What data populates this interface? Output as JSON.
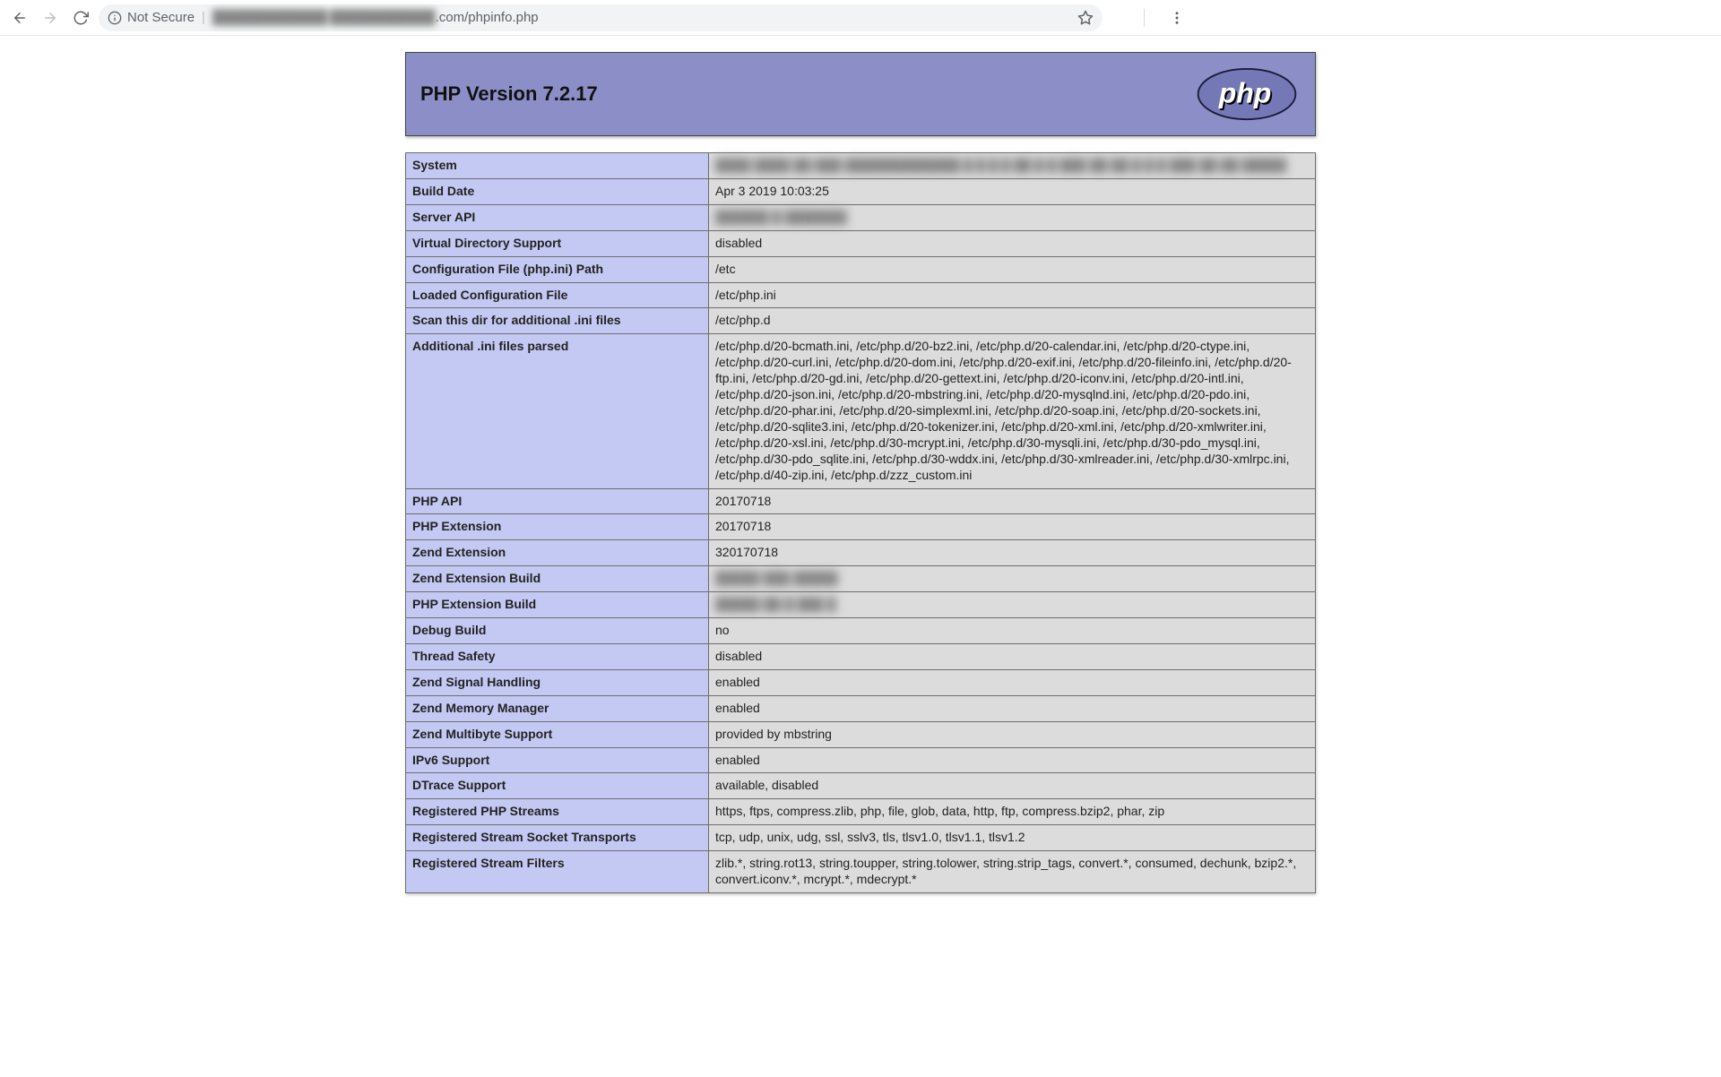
{
  "browser": {
    "security_label": "Not Secure",
    "url_redacted": "████████████ ███████████",
    "url_suffix": ".com/phpinfo.php"
  },
  "header": {
    "title": "PHP Version 7.2.17",
    "logo_text": "php"
  },
  "rows": [
    {
      "key": "System",
      "val": "████ ████ ██ ███ █████████████ █ █ █ █ ██ █ █ ███ ██ ██ █ █ █ ███ ██ ██ █████",
      "blur": true
    },
    {
      "key": "Build Date",
      "val": "Apr 3 2019 10:03:25"
    },
    {
      "key": "Server API",
      "val": "██████ █ ███████",
      "blur": true
    },
    {
      "key": "Virtual Directory Support",
      "val": "disabled"
    },
    {
      "key": "Configuration File (php.ini) Path",
      "val": "/etc"
    },
    {
      "key": "Loaded Configuration File",
      "val": "/etc/php.ini"
    },
    {
      "key": "Scan this dir for additional .ini files",
      "val": "/etc/php.d"
    },
    {
      "key": "Additional .ini files parsed",
      "val": "/etc/php.d/20-bcmath.ini, /etc/php.d/20-bz2.ini, /etc/php.d/20-calendar.ini, /etc/php.d/20-ctype.ini, /etc/php.d/20-curl.ini, /etc/php.d/20-dom.ini, /etc/php.d/20-exif.ini, /etc/php.d/20-fileinfo.ini, /etc/php.d/20-ftp.ini, /etc/php.d/20-gd.ini, /etc/php.d/20-gettext.ini, /etc/php.d/20-iconv.ini, /etc/php.d/20-intl.ini, /etc/php.d/20-json.ini, /etc/php.d/20-mbstring.ini, /etc/php.d/20-mysqlnd.ini, /etc/php.d/20-pdo.ini, /etc/php.d/20-phar.ini, /etc/php.d/20-simplexml.ini, /etc/php.d/20-soap.ini, /etc/php.d/20-sockets.ini, /etc/php.d/20-sqlite3.ini, /etc/php.d/20-tokenizer.ini, /etc/php.d/20-xml.ini, /etc/php.d/20-xmlwriter.ini, /etc/php.d/20-xsl.ini, /etc/php.d/30-mcrypt.ini, /etc/php.d/30-mysqli.ini, /etc/php.d/30-pdo_mysql.ini, /etc/php.d/30-pdo_sqlite.ini, /etc/php.d/30-wddx.ini, /etc/php.d/30-xmlreader.ini, /etc/php.d/30-xmlrpc.ini, /etc/php.d/40-zip.ini, /etc/php.d/zzz_custom.ini"
    },
    {
      "key": "PHP API",
      "val": "20170718"
    },
    {
      "key": "PHP Extension",
      "val": "20170718"
    },
    {
      "key": "Zend Extension",
      "val": "320170718"
    },
    {
      "key": "Zend Extension Build",
      "val": "█████ ███ █████",
      "blur": true
    },
    {
      "key": "PHP Extension Build",
      "val": "█████ ██ █ ███ █",
      "blur": true
    },
    {
      "key": "Debug Build",
      "val": "no"
    },
    {
      "key": "Thread Safety",
      "val": "disabled"
    },
    {
      "key": "Zend Signal Handling",
      "val": "enabled"
    },
    {
      "key": "Zend Memory Manager",
      "val": "enabled"
    },
    {
      "key": "Zend Multibyte Support",
      "val": "provided by mbstring"
    },
    {
      "key": "IPv6 Support",
      "val": "enabled"
    },
    {
      "key": "DTrace Support",
      "val": "available, disabled"
    },
    {
      "key": "Registered PHP Streams",
      "val": "https, ftps, compress.zlib, php, file, glob, data, http, ftp, compress.bzip2, phar, zip"
    },
    {
      "key": "Registered Stream Socket Transports",
      "val": "tcp, udp, unix, udg, ssl, sslv3, tls, tlsv1.0, tlsv1.1, tlsv1.2"
    },
    {
      "key": "Registered Stream Filters",
      "val": "zlib.*, string.rot13, string.toupper, string.tolower, string.strip_tags, convert.*, consumed, dechunk, bzip2.*, convert.iconv.*, mcrypt.*, mdecrypt.*"
    }
  ]
}
